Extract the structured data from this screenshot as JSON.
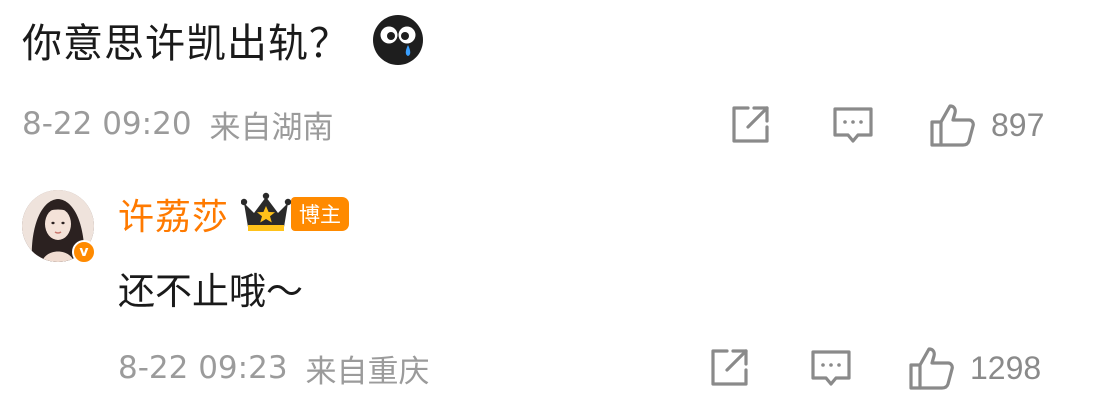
{
  "comment": {
    "text": "你意思许凯出轨？",
    "emoji": "crying-face-emoji",
    "timestamp": "8-22 09:20",
    "location": "来自湖南",
    "likes": "897"
  },
  "reply": {
    "author": "许荔莎",
    "author_color": "#ff7a00",
    "badge_label": "博主",
    "badge_color": "#ff8a00",
    "verified": true,
    "text": "还不止哦～",
    "timestamp": "8-22 09:23",
    "location": "来自重庆",
    "likes": "1298"
  },
  "icons": {
    "share": "share-icon",
    "comment": "comment-icon",
    "like": "thumbs-up-icon",
    "crown": "crown-icon"
  },
  "colors": {
    "meta": "#9b9b9b",
    "icon": "#8a8a8a",
    "text": "#1a1a1a"
  }
}
